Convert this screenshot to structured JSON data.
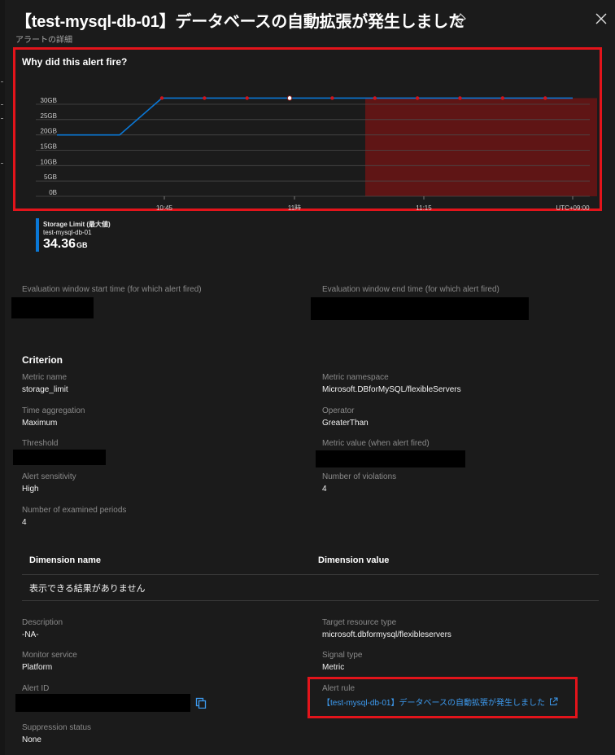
{
  "header": {
    "title": "【test-mysql-db-01】データベースの自動拡張が発生しました",
    "subtitle": "アラートの詳細"
  },
  "chart_section": {
    "title": "Why did this alert fire?"
  },
  "chart_data": {
    "type": "line",
    "title": "Why did this alert fire?",
    "y_ticks": [
      "0B",
      "5GB",
      "10GB",
      "15GB",
      "20GB",
      "25GB",
      "30GB"
    ],
    "x_ticks": [
      "10:45",
      "11時",
      "11:15",
      "UTC+09:00"
    ],
    "ylim": [
      0,
      34.36
    ],
    "series": [
      {
        "name": "Storage Limit (最大値)",
        "color": "#0a78d7",
        "x": [
          "10:34",
          "10:39",
          "10:44",
          "10:49",
          "10:54",
          "10:59",
          "11:04",
          "11:09",
          "11:14",
          "11:19",
          "11:24",
          "11:29",
          "11:34"
        ],
        "values": [
          20,
          20,
          20,
          32,
          32,
          32,
          32,
          32,
          32,
          32,
          32,
          32,
          32
        ]
      }
    ],
    "alert_region": {
      "from": "10:59",
      "to": "11:34",
      "color": "#6b1414"
    },
    "grid": true,
    "legend": "bottom-left"
  },
  "legend": {
    "line1": "Storage Limit (最大値)",
    "line2": "test-mysql-db-01",
    "value": "34.36",
    "unit": "GB"
  },
  "window": {
    "start_label": "Evaluation window start time (for which alert fired)",
    "end_label": "Evaluation window end time (for which alert fired)"
  },
  "criterion": {
    "heading": "Criterion",
    "metric_name_label": "Metric name",
    "metric_name": "storage_limit",
    "metric_namespace_label": "Metric namespace",
    "metric_namespace": "Microsoft.DBforMySQL/flexibleServers",
    "time_aggregation_label": "Time aggregation",
    "time_aggregation": "Maximum",
    "operator_label": "Operator",
    "operator": "GreaterThan",
    "threshold_label": "Threshold",
    "metric_value_label": "Metric value (when alert fired)",
    "alert_sensitivity_label": "Alert sensitivity",
    "alert_sensitivity": "High",
    "violations_label": "Number of violations",
    "violations": "4",
    "examined_label": "Number of examined periods",
    "examined": "4"
  },
  "dimension_table": {
    "col1": "Dimension name",
    "col2": "Dimension value",
    "empty": "表示できる結果がありません"
  },
  "details": {
    "description_label": "Description",
    "description": "-NA-",
    "target_type_label": "Target resource type",
    "target_type": "microsoft.dbformysql/flexibleservers",
    "monitor_service_label": "Monitor service",
    "monitor_service": "Platform",
    "signal_type_label": "Signal type",
    "signal_type": "Metric",
    "alert_id_label": "Alert ID",
    "alert_rule_label": "Alert rule",
    "alert_rule": "【test-mysql-db-01】データベースの自動拡張が発生しました",
    "suppression_label": "Suppression status",
    "suppression": "None"
  },
  "colors": {
    "background": "#1b1b1b",
    "accent": "#0a78d7",
    "link": "#3d9bf0",
    "highlight": "#e3141b",
    "alert_fill": "#6b1414"
  }
}
